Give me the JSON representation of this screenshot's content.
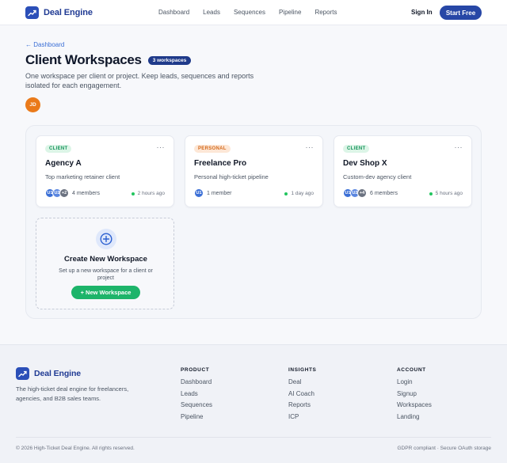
{
  "brand": {
    "name": "Deal Engine"
  },
  "nav": {
    "links": [
      "Dashboard",
      "Leads",
      "Sequences",
      "Pipeline",
      "Reports"
    ],
    "signin": "Sign In",
    "start": "Start Free"
  },
  "header": {
    "back": "← Dashboard",
    "title": "Client Workspaces",
    "badge": "3 workspaces",
    "subtitle": "One workspace per client or project. Keep leads, sequences and reports isolated for each engagement.",
    "avatar": "JD"
  },
  "workspaces": [
    {
      "tag": "CLIENT",
      "tag_type": "client",
      "name": "Agency A",
      "desc": "Top marketing retainer client",
      "avatars": [
        "U1",
        "U2",
        "+2"
      ],
      "members": "4 members",
      "activity": "2 hours ago"
    },
    {
      "tag": "PERSONAL",
      "tag_type": "personal",
      "name": "Freelance Pro",
      "desc": "Personal high-ticket pipeline",
      "avatars": [
        "U1"
      ],
      "members": "1 member",
      "activity": "1 day ago"
    },
    {
      "tag": "CLIENT",
      "tag_type": "client",
      "name": "Dev Shop X",
      "desc": "Custom-dev agency client",
      "avatars": [
        "U1",
        "U2",
        "+4"
      ],
      "members": "6 members",
      "activity": "5 hours ago"
    }
  ],
  "menu_glyph": "···",
  "create": {
    "title": "Create New Workspace",
    "desc": "Set up a new workspace for a client or project",
    "button": "+ New Workspace"
  },
  "footer": {
    "brand": "Deal Engine",
    "desc": "The high-ticket deal engine for freelancers, agencies, and B2B sales teams.",
    "columns": [
      {
        "head": "PRODUCT",
        "links": [
          "Dashboard",
          "Leads",
          "Sequences",
          "Pipeline"
        ]
      },
      {
        "head": "INSIGHTS",
        "links": [
          "Deal",
          "AI Coach",
          "Reports",
          "ICP"
        ]
      },
      {
        "head": "ACCOUNT",
        "links": [
          "Login",
          "Signup",
          "Workspaces",
          "Landing"
        ]
      }
    ],
    "copyright": "© 2026 High-Ticket Deal Engine. All rights reserved.",
    "gdpr": "GDPR compliant · Secure OAuth storage"
  }
}
